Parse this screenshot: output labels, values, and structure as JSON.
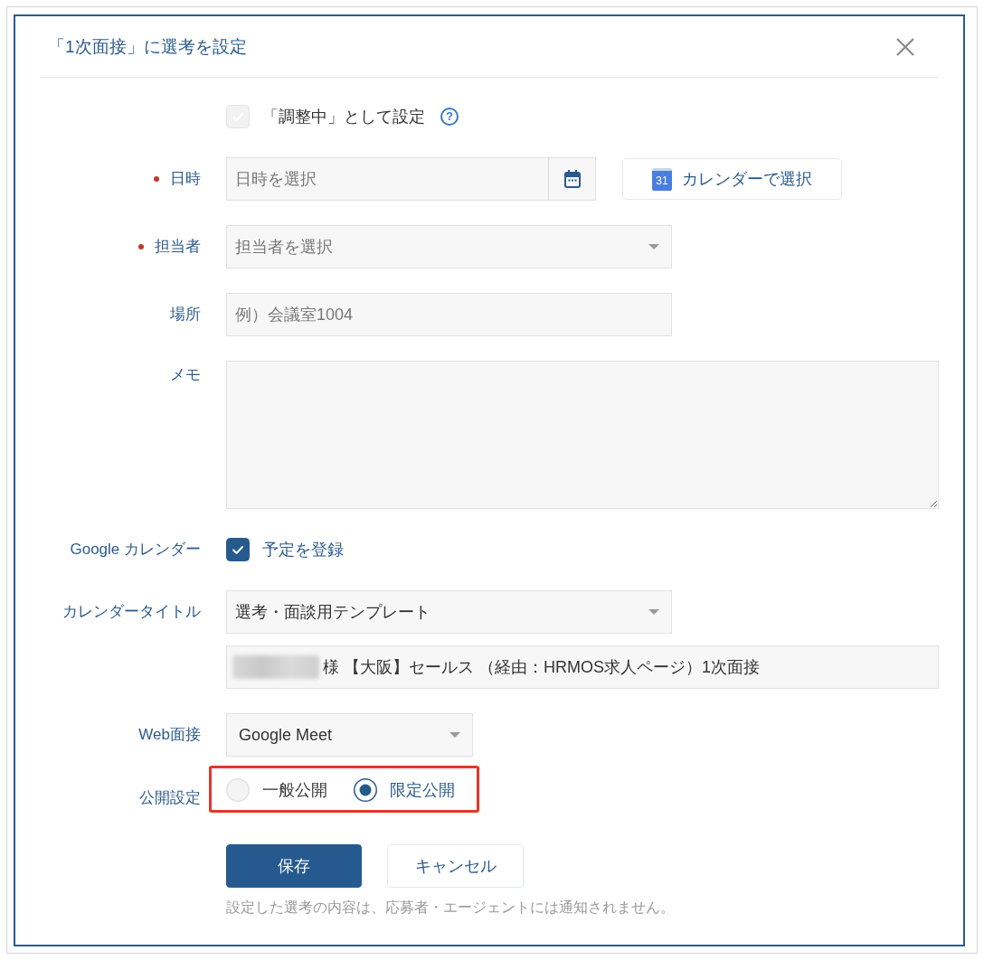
{
  "dialog": {
    "title": "「1次面接」に選考を設定"
  },
  "pending": {
    "label": "「調整中」として設定",
    "checked": false,
    "disabled": true,
    "help": "?"
  },
  "fields": [
    {
      "kind": "datetime",
      "label": "日時",
      "required": true,
      "placeholder": "日時を選択",
      "button": {
        "icon_label": "31",
        "label": "カレンダーで選択"
      }
    },
    {
      "kind": "select",
      "label": "担当者",
      "required": true,
      "placeholder": "担当者を選択"
    },
    {
      "kind": "text",
      "label": "場所",
      "required": false,
      "placeholder": "例）会議室1004"
    },
    {
      "kind": "textarea",
      "label": "メモ",
      "required": false
    },
    {
      "kind": "checkbox",
      "label": "Google カレンダー",
      "required": false,
      "option": "予定を登録",
      "checked": true
    },
    {
      "kind": "title",
      "label": "カレンダータイトル",
      "required": false,
      "value": "選考・面談用テンプレート",
      "preview": "様 【大阪】セールス （経由：HRMOS求人ページ）1次面接",
      "name_redacted": true
    },
    {
      "kind": "short_select",
      "label": "Web面接",
      "required": false,
      "value": "Google Meet"
    },
    {
      "kind": "radio",
      "label": "公開設定",
      "required": false,
      "highlighted": true,
      "options": [
        {
          "label": "一般公開",
          "selected": false
        },
        {
          "label": "限定公開",
          "selected": true
        }
      ]
    }
  ],
  "actions": [
    {
      "kind": "primary",
      "label": "保存"
    },
    {
      "kind": "secondary",
      "label": "キャンセル"
    }
  ],
  "note": "設定した選考の内容は、応募者・エージェントには通知されません。"
}
